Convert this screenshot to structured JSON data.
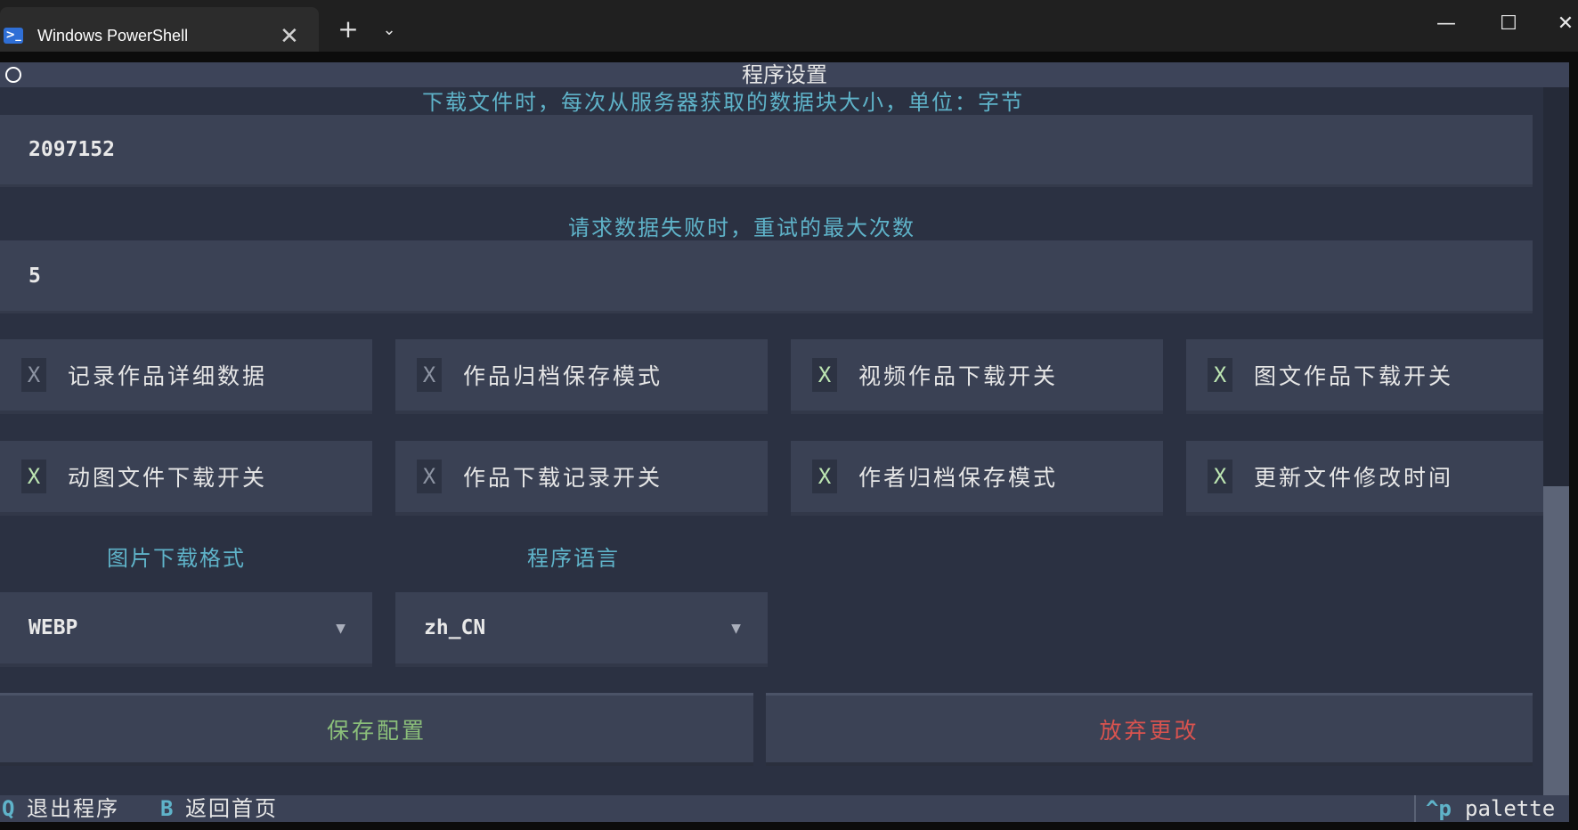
{
  "window": {
    "tab_title": "Windows PowerShell",
    "tab_icon_glyph": ">_",
    "close_tab_glyph": "✕",
    "new_tab_glyph": "+",
    "dropdown_glyph": "⌄",
    "minimize_glyph": "—",
    "maximize_glyph": "☐",
    "close_glyph": "✕"
  },
  "header": {
    "title": "程序设置"
  },
  "settings": {
    "chunk_label": "下载文件时，每次从服务器获取的数据块大小，单位：字节",
    "chunk_value": "2097152",
    "retry_label": "请求数据失败时，重试的最大次数",
    "retry_value": "5"
  },
  "checkboxes": [
    {
      "label": "记录作品详细数据",
      "mark": "X",
      "checked": false
    },
    {
      "label": "作品归档保存模式",
      "mark": "X",
      "checked": false
    },
    {
      "label": "视频作品下载开关",
      "mark": "X",
      "checked": true
    },
    {
      "label": "图文作品下载开关",
      "mark": "X",
      "checked": true
    },
    {
      "label": "动图文件下载开关",
      "mark": "X",
      "checked": true
    },
    {
      "label": "作品下载记录开关",
      "mark": "X",
      "checked": false
    },
    {
      "label": "作者归档保存模式",
      "mark": "X",
      "checked": true
    },
    {
      "label": "更新文件修改时间",
      "mark": "X",
      "checked": true
    }
  ],
  "selects": {
    "image_format_label": "图片下载格式",
    "image_format_value": "WEBP",
    "language_label": "程序语言",
    "language_value": "zh_CN",
    "arrow_glyph": "▼"
  },
  "buttons": {
    "save": "保存配置",
    "discard": "放弃更改"
  },
  "footer": {
    "quit_key": "Q",
    "quit_label": "退出程序",
    "back_key": "B",
    "back_label": "返回首页",
    "palette_key": "^p",
    "palette_label": "palette"
  },
  "colors": {
    "save_text": "#8bbf7a",
    "discard_text": "#d9534f",
    "accent": "#5fb3c9"
  }
}
